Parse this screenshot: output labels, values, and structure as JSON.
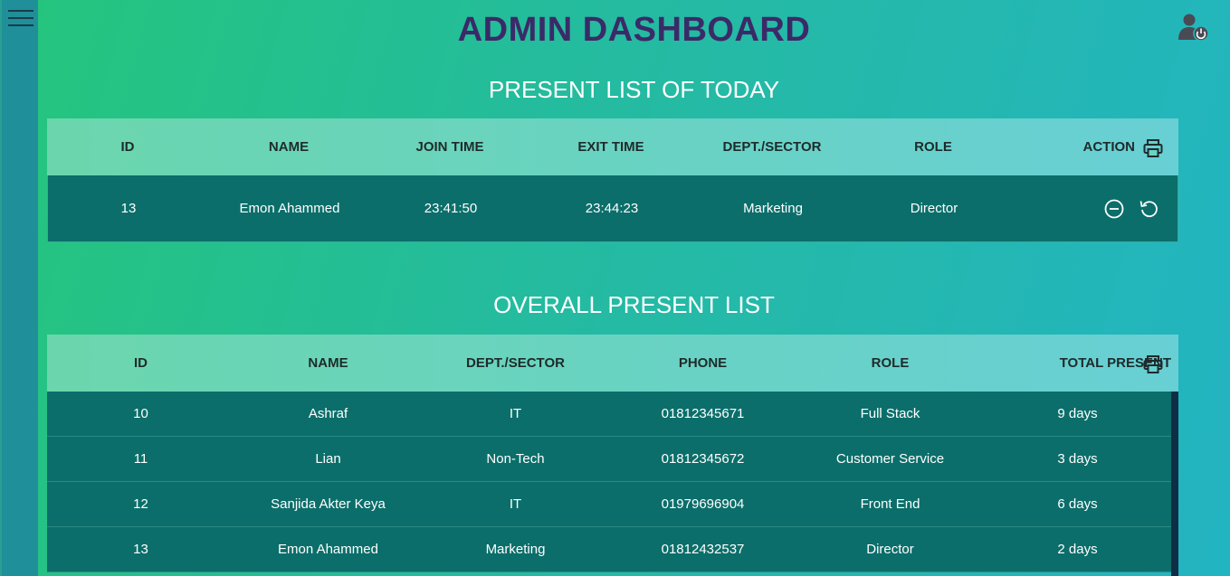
{
  "header": {
    "title": "ADMIN DASHBOARD"
  },
  "today": {
    "title": "PRESENT LIST OF TODAY",
    "columns": [
      "ID",
      "NAME",
      "JOIN TIME",
      "EXIT TIME",
      "DEPT./SECTOR",
      "ROLE",
      "ACTION"
    ],
    "rows": [
      {
        "id": "13",
        "name": "Emon Ahammed",
        "join": "23:41:50",
        "exit": "23:44:23",
        "dept": "Marketing",
        "role": "Director"
      }
    ]
  },
  "overall": {
    "title": "OVERALL PRESENT LIST",
    "columns": [
      "ID",
      "NAME",
      "DEPT./SECTOR",
      "PHONE",
      "ROLE",
      "TOTAL PRESENT"
    ],
    "rows": [
      {
        "id": "10",
        "name": "Ashraf",
        "dept": "IT",
        "phone": "01812345671",
        "role": "Full Stack",
        "total": "9 days"
      },
      {
        "id": "11",
        "name": "Lian",
        "dept": "Non-Tech",
        "phone": "01812345672",
        "role": "Customer Service",
        "total": "3 days"
      },
      {
        "id": "12",
        "name": "Sanjida Akter Keya",
        "dept": "IT",
        "phone": "01979696904",
        "role": "Front End",
        "total": "6 days"
      },
      {
        "id": "13",
        "name": "Emon Ahammed",
        "dept": "Marketing",
        "phone": "01812432537",
        "role": "Director",
        "total": "2 days"
      }
    ]
  },
  "icons": {
    "menu": "hamburger-menu-icon",
    "admin": "admin-user-icon",
    "print": "printer-icon",
    "remove": "minus-circle-icon",
    "undo": "undo-icon"
  },
  "colors": {
    "title": "#3b2a68",
    "row_bg": "#0b6e6a",
    "sidebar": "#1f8f9a"
  }
}
